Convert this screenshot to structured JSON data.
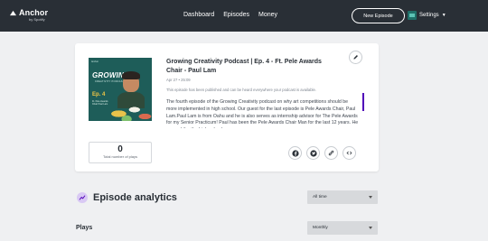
{
  "nav": {
    "logo_text": "Anchor",
    "logo_subtext": "by Spotify",
    "links": [
      "Dashboard",
      "Episodes",
      "Money"
    ],
    "new_episode_label": "New Episode",
    "settings_label": "Settings"
  },
  "episode": {
    "title": "Growing Creativity Podcast | Ep. 4 - Ft. Pele Awards Chair - Paul Lam",
    "meta": "Apr 27 • 25:09",
    "status_note": "This episode has been published and can be heard everywhere your podcast is available.",
    "description": "The fourth episode of the Growing Creativity podcast on why art competitions should be more implemented in high school. Our guest for the last episode is Pele Awards Chair, Paul Lam.Paul Lam is from Oahu and he is also serves as internship advisor for The Pele Awards for my Senior Practicum! Paul has been the Pele Awards Chair Man for the last 12 years. He opened the the high school",
    "plays_count": "0",
    "plays_label": "Total number of plays",
    "cover": {
      "top_text": "Anchor",
      "title": "GROWING",
      "subtitle": "CREATIVITY PODCAST",
      "episode": "Ep. 4",
      "episode_sub": "Ft. Pele Awards Chair Paul Lam"
    }
  },
  "analytics": {
    "title": "Episode analytics",
    "range_select": "All time",
    "plays_heading": "Plays",
    "interval_select": "Monthly"
  },
  "colors": {
    "nav_bg": "#292f36",
    "accent": "#5000b9",
    "page_bg": "#eff0f2"
  },
  "icons": [
    "edit-icon",
    "facebook-icon",
    "twitter-icon",
    "link-icon",
    "embed-icon",
    "analytics-icon"
  ]
}
